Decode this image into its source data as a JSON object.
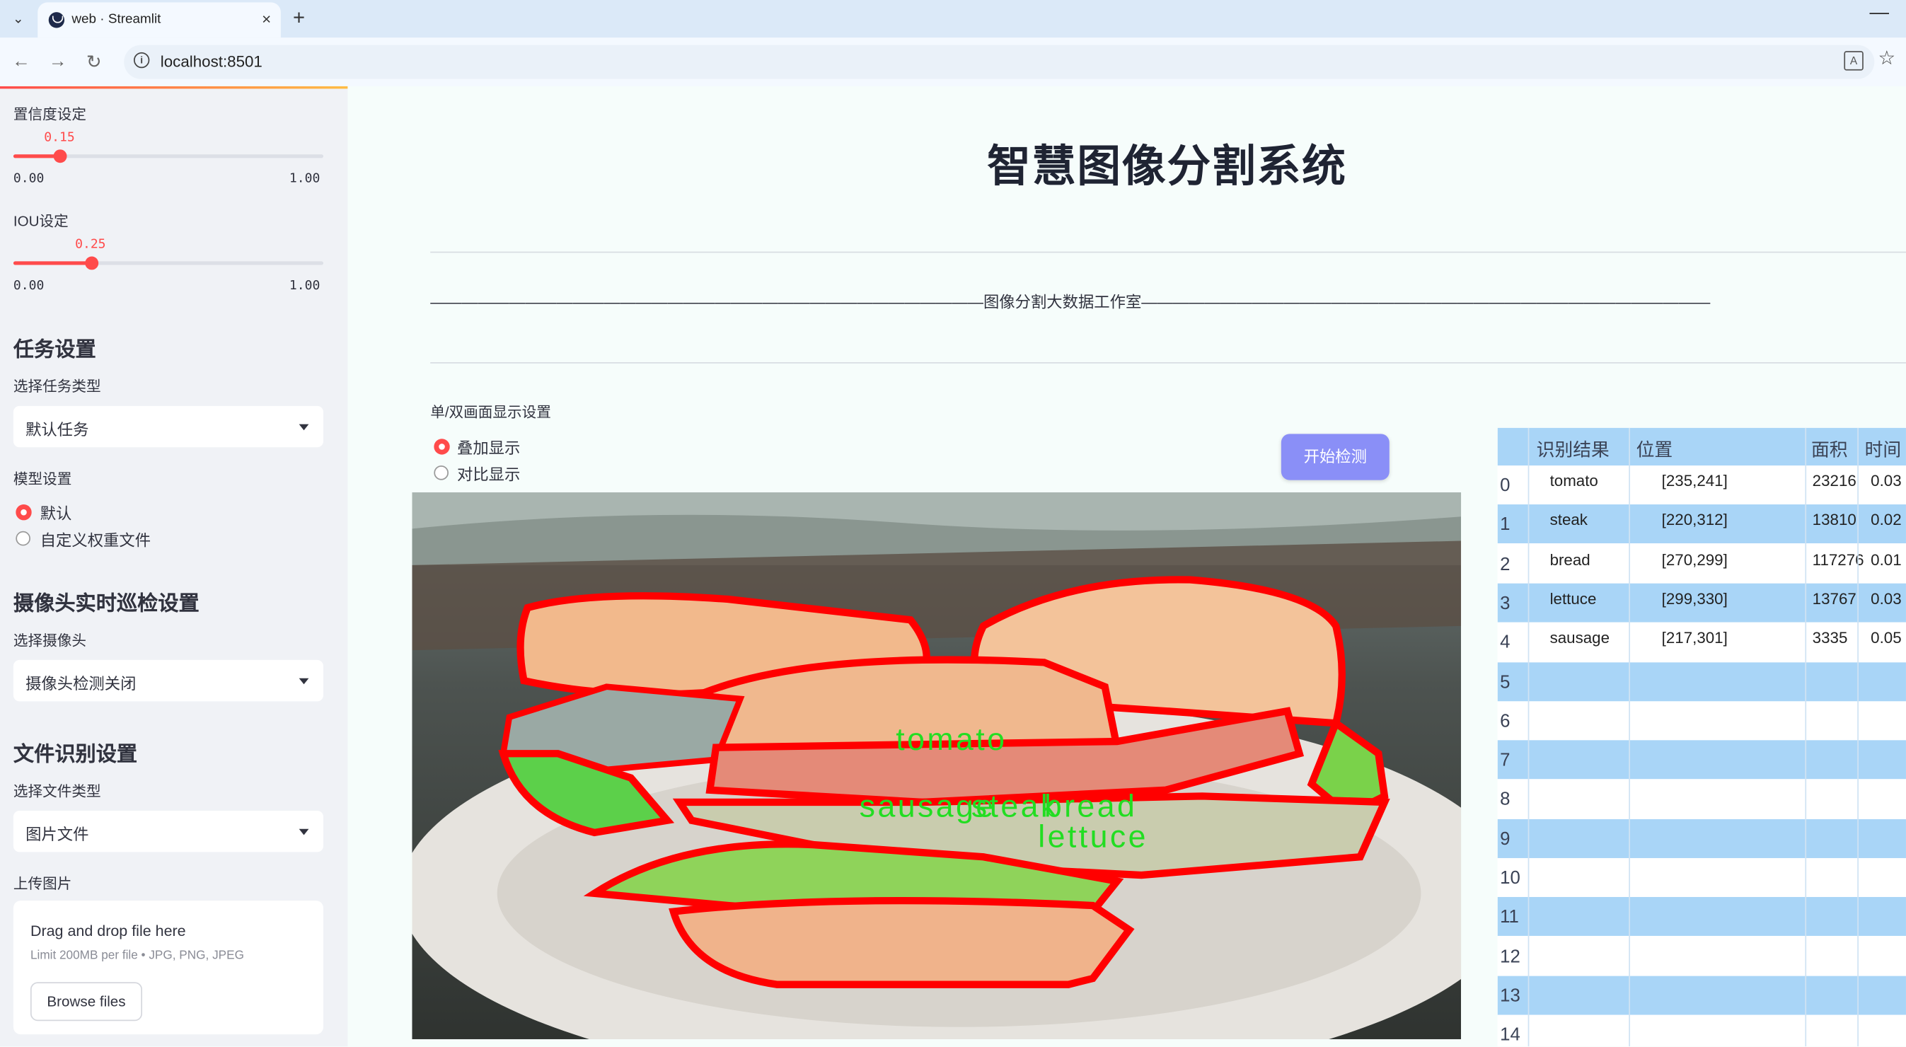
{
  "browser": {
    "tab_title": "web · Streamlit",
    "tab_close": "×",
    "new_tab": "+",
    "minimize": "—",
    "url": "localhost:8501"
  },
  "sidebar": {
    "confidence_label": "置信度设定",
    "confidence_value": "0.15",
    "confidence_fraction": 0.15,
    "iou_label": "IOU设定",
    "iou_value": "0.25",
    "iou_fraction": 0.25,
    "slider_min": "0.00",
    "slider_max": "1.00",
    "task_header": "任务设置",
    "task_type_label": "选择任务类型",
    "task_type_value": "默认任务",
    "model_label": "模型设置",
    "model_options": [
      "默认",
      "自定义权重文件"
    ],
    "camera_header": "摄像头实时巡检设置",
    "camera_label": "选择摄像头",
    "camera_value": "摄像头检测关闭",
    "file_header": "文件识别设置",
    "file_type_label": "选择文件类型",
    "file_type_value": "图片文件",
    "upload_label": "上传图片",
    "upload_title": "Drag and drop file here",
    "upload_sub": "Limit 200MB per file • JPG, PNG, JPEG",
    "upload_button": "Browse files"
  },
  "main": {
    "title": "智慧图像分割系统",
    "divider_text": "———————————————————————————————————图像分割大数据工作室————————————————————————————————————",
    "display_label": "单/双画面显示设置",
    "display_options": [
      "叠加显示",
      "对比显示"
    ],
    "start_button": "开始检测",
    "overlay_labels": [
      "tomato",
      "sausage",
      "steak",
      "bread",
      "lettuce"
    ]
  },
  "table": {
    "headers": [
      "识别结果",
      "位置",
      "面积",
      "时间"
    ],
    "rows": [
      {
        "idx": "0",
        "label": "tomato",
        "pos": "[235,241]",
        "area": "23216",
        "time": "0.03"
      },
      {
        "idx": "1",
        "label": "steak",
        "pos": "[220,312]",
        "area": "13810",
        "time": "0.02"
      },
      {
        "idx": "2",
        "label": "bread",
        "pos": "[270,299]",
        "area": "117276",
        "time": "0.01"
      },
      {
        "idx": "3",
        "label": "lettuce",
        "pos": "[299,330]",
        "area": "13767",
        "time": "0.03"
      },
      {
        "idx": "4",
        "label": "sausage",
        "pos": "[217,301]",
        "area": "3335",
        "time": "0.05"
      },
      {
        "idx": "5",
        "label": "",
        "pos": "",
        "area": "",
        "time": ""
      },
      {
        "idx": "6",
        "label": "",
        "pos": "",
        "area": "",
        "time": ""
      },
      {
        "idx": "7",
        "label": "",
        "pos": "",
        "area": "",
        "time": ""
      },
      {
        "idx": "8",
        "label": "",
        "pos": "",
        "area": "",
        "time": ""
      },
      {
        "idx": "9",
        "label": "",
        "pos": "",
        "area": "",
        "time": ""
      },
      {
        "idx": "10",
        "label": "",
        "pos": "",
        "area": "",
        "time": ""
      },
      {
        "idx": "11",
        "label": "",
        "pos": "",
        "area": "",
        "time": ""
      },
      {
        "idx": "12",
        "label": "",
        "pos": "",
        "area": "",
        "time": ""
      },
      {
        "idx": "13",
        "label": "",
        "pos": "",
        "area": "",
        "time": ""
      },
      {
        "idx": "14",
        "label": "",
        "pos": "",
        "area": "",
        "time": ""
      }
    ]
  },
  "colors": {
    "accent": "#ff4b4b",
    "button": "#8a8ff7",
    "table_stripe": "#a9d5f7",
    "mask_outline": "#ff0000",
    "mask_label": "#22dd22"
  }
}
